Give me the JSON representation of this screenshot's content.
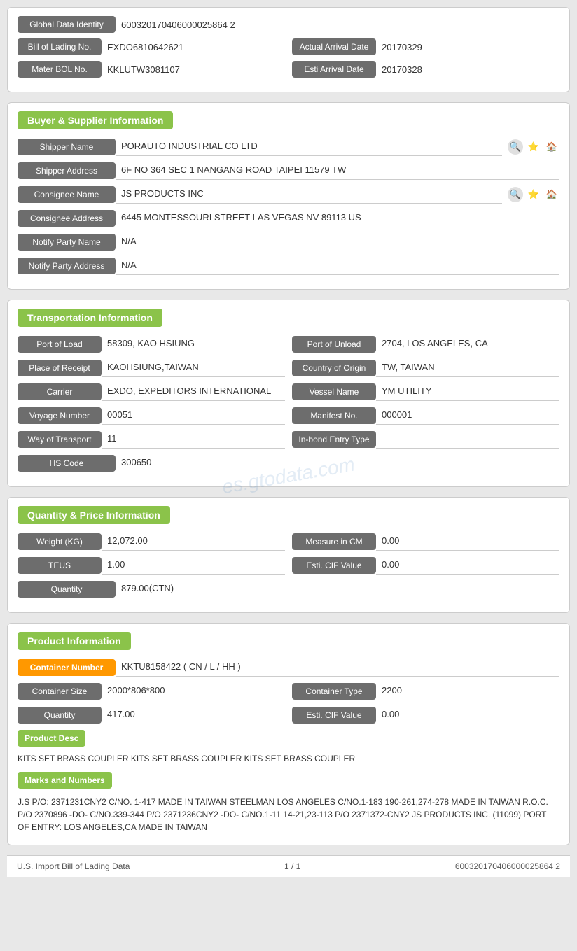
{
  "top_card": {
    "global_data_identity_label": "Global Data Identity",
    "global_data_identity_value": "600320170406000025864 2",
    "bill_of_lading_label": "Bill of Lading No.",
    "bill_of_lading_value": "EXDO6810642621",
    "actual_arrival_date_label": "Actual Arrival Date",
    "actual_arrival_date_value": "20170329",
    "mater_bol_label": "Mater BOL No.",
    "mater_bol_value": "KKLUTW3081107",
    "esti_arrival_date_label": "Esti Arrival Date",
    "esti_arrival_date_value": "20170328"
  },
  "buyer_supplier": {
    "section_title": "Buyer & Supplier Information",
    "shipper_name_label": "Shipper Name",
    "shipper_name_value": "PORAUTO INDUSTRIAL CO LTD",
    "shipper_address_label": "Shipper Address",
    "shipper_address_value": "6F NO 364 SEC 1 NANGANG ROAD TAIPEI 11579 TW",
    "consignee_name_label": "Consignee Name",
    "consignee_name_value": "JS PRODUCTS INC",
    "consignee_address_label": "Consignee Address",
    "consignee_address_value": "6445 MONTESSOURI STREET LAS VEGAS NV 89113 US",
    "notify_party_name_label": "Notify Party Name",
    "notify_party_name_value": "N/A",
    "notify_party_address_label": "Notify Party Address",
    "notify_party_address_value": "N/A"
  },
  "transportation": {
    "section_title": "Transportation Information",
    "port_of_load_label": "Port of Load",
    "port_of_load_value": "58309, KAO HSIUNG",
    "port_of_unload_label": "Port of Unload",
    "port_of_unload_value": "2704, LOS ANGELES, CA",
    "place_of_receipt_label": "Place of Receipt",
    "place_of_receipt_value": "KAOHSIUNG,TAIWAN",
    "country_of_origin_label": "Country of Origin",
    "country_of_origin_value": "TW, TAIWAN",
    "carrier_label": "Carrier",
    "carrier_value": "EXDO, EXPEDITORS INTERNATIONAL",
    "vessel_name_label": "Vessel Name",
    "vessel_name_value": "YM UTILITY",
    "voyage_number_label": "Voyage Number",
    "voyage_number_value": "00051",
    "manifest_no_label": "Manifest No.",
    "manifest_no_value": "000001",
    "way_of_transport_label": "Way of Transport",
    "way_of_transport_value": "11",
    "in_bond_entry_type_label": "In-bond Entry Type",
    "in_bond_entry_type_value": "",
    "hs_code_label": "HS Code",
    "hs_code_value": "300650"
  },
  "quantity_price": {
    "section_title": "Quantity & Price Information",
    "weight_kg_label": "Weight (KG)",
    "weight_kg_value": "12,072.00",
    "measure_in_cm_label": "Measure in CM",
    "measure_in_cm_value": "0.00",
    "teus_label": "TEUS",
    "teus_value": "1.00",
    "esti_cif_value_label": "Esti. CIF Value",
    "esti_cif_value_1": "0.00",
    "quantity_label": "Quantity",
    "quantity_value": "879.00(CTN)"
  },
  "product_information": {
    "section_title": "Product Information",
    "container_number_label": "Container Number",
    "container_number_value": "KKTU8158422 ( CN / L / HH )",
    "container_size_label": "Container Size",
    "container_size_value": "2000*806*800",
    "container_type_label": "Container Type",
    "container_type_value": "2200",
    "quantity_label": "Quantity",
    "quantity_value": "417.00",
    "esti_cif_label": "Esti. CIF Value",
    "esti_cif_value": "0.00",
    "product_desc_label": "Product Desc",
    "product_desc_text": "KITS SET BRASS COUPLER KITS SET BRASS COUPLER KITS SET BRASS COUPLER",
    "marks_and_numbers_label": "Marks and Numbers",
    "marks_and_numbers_text": "J.S P/O: 2371231CNY2 C/NO. 1-417 MADE IN TAIWAN STEELMAN LOS ANGELES C/NO.1-183 190-261,274-278 MADE IN TAIWAN R.O.C. P/O 2370896 -DO- C/NO.339-344 P/O 2371236CNY2 -DO- C/NO.1-11 14-21,23-113 P/O 2371372-CNY2 JS PRODUCTS INC. (11099) PORT OF ENTRY: LOS ANGELES,CA MADE IN TAIWAN"
  },
  "footer": {
    "left_text": "U.S. Import Bill of Lading Data",
    "center_text": "1 / 1",
    "right_text": "600320170406000025864 2"
  },
  "watermark": "es.gtodata.com"
}
